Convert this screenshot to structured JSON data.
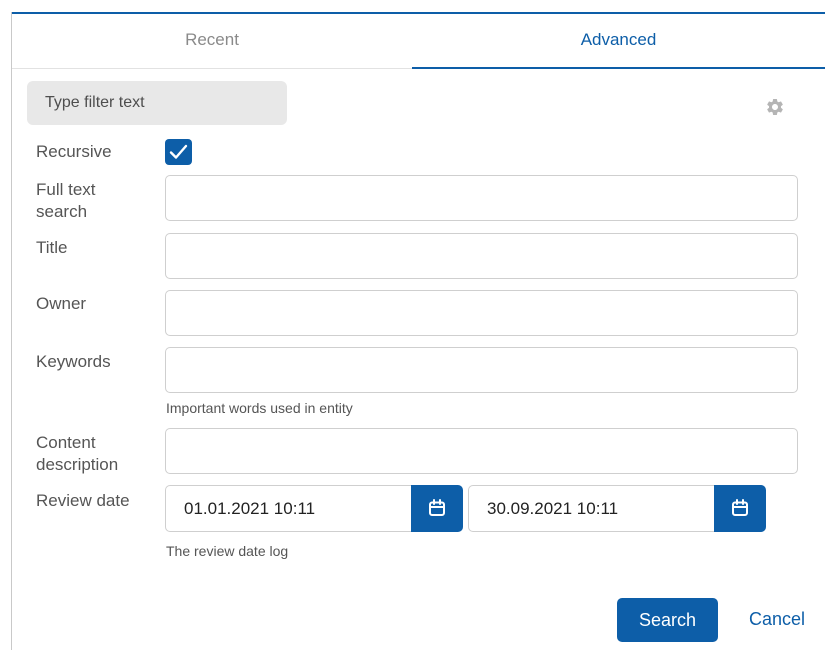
{
  "tabs": {
    "recent": "Recent",
    "advanced": "Advanced"
  },
  "filter": {
    "placeholder": "Type filter text"
  },
  "form": {
    "recursive_label": "Recursive",
    "recursive_checked": true,
    "fulltext_label_line1": "Full text",
    "fulltext_label_line2": "search",
    "fulltext_value": "",
    "title_label": "Title",
    "title_value": "",
    "owner_label": "Owner",
    "owner_value": "",
    "keywords_label": "Keywords",
    "keywords_value": "",
    "keywords_help": "Important words used in entity",
    "content_label_line1": "Content",
    "content_label_line2": "description",
    "content_value": "",
    "review_label": "Review date",
    "review_from": "01.01.2021 10:11",
    "review_to": "30.09.2021 10:11",
    "review_help": "The review date log"
  },
  "actions": {
    "search": "Search",
    "cancel": "Cancel"
  },
  "icons": {
    "settings": "gear-icon",
    "check": "check-icon",
    "calendar": "calendar-icon"
  },
  "colors": {
    "accent": "#0d5ea8"
  }
}
